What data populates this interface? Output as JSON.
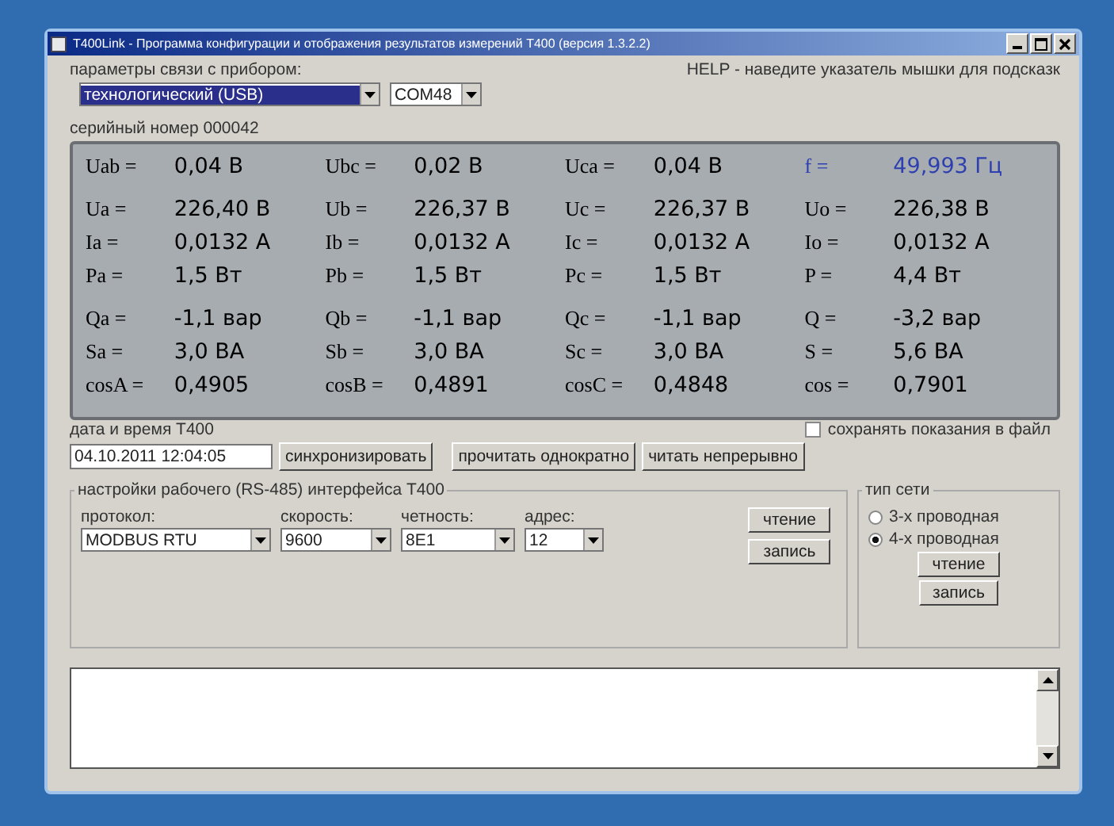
{
  "window": {
    "title": "T400Link - Программа конфигурации и отображения результатов измерений Т400 (версия 1.3.2.2)"
  },
  "connection": {
    "label": "параметры связи с прибором:",
    "help": "HELP - наведите указатель мышки для подсказк",
    "dropdowns": [
      {
        "value": "технологический (USB)",
        "focused": true
      },
      {
        "value": "COM48",
        "focused": false
      }
    ]
  },
  "readings": {
    "title": "серийный номер 000042",
    "rows": [
      [
        {
          "label": "Uab =",
          "value": "0,04 В",
          "color": "#000000"
        },
        {
          "label": "Ubc =",
          "value": "0,02 В",
          "color": "#000000"
        },
        {
          "label": "Uca =",
          "value": "0,04 В",
          "color": "#000000"
        },
        {
          "label": "f =",
          "value": "49,993 Гц",
          "color": "#2e3fb0"
        }
      ],
      [
        {
          "label": "Ua =",
          "value": "226,40 В",
          "color": "#000000"
        },
        {
          "label": "Ub =",
          "value": "226,37 В",
          "color": "#000000"
        },
        {
          "label": "Uc =",
          "value": "226,37 В",
          "color": "#000000"
        },
        {
          "label": "Uo =",
          "value": "226,38 В",
          "color": "#000000"
        }
      ],
      [
        {
          "label": "Ia =",
          "value": "0,0132 А",
          "color": "#000000"
        },
        {
          "label": "Ib =",
          "value": "0,0132 А",
          "color": "#000000"
        },
        {
          "label": "Ic =",
          "value": "0,0132 А",
          "color": "#000000"
        },
        {
          "label": "Io =",
          "value": "0,0132 А",
          "color": "#000000"
        }
      ],
      [
        {
          "label": "Pa =",
          "value": "1,5 Вт",
          "color": "#000000"
        },
        {
          "label": "Pb =",
          "value": "1,5 Вт",
          "color": "#000000"
        },
        {
          "label": "Pc =",
          "value": "1,5 Вт",
          "color": "#000000"
        },
        {
          "label": "P =",
          "value": "4,4 Вт",
          "color": "#000000"
        }
      ],
      [
        {
          "label": "Qa =",
          "value": "-1,1 вар",
          "color": "#000000"
        },
        {
          "label": "Qb =",
          "value": "-1,1 вар",
          "color": "#000000"
        },
        {
          "label": "Qc =",
          "value": "-1,1 вар",
          "color": "#000000"
        },
        {
          "label": "Q =",
          "value": "-3,2 вар",
          "color": "#000000"
        }
      ],
      [
        {
          "label": "Sa =",
          "value": "3,0 ВА",
          "color": "#000000"
        },
        {
          "label": "Sb =",
          "value": "3,0 ВА",
          "color": "#000000"
        },
        {
          "label": "Sc =",
          "value": "3,0 ВА",
          "color": "#000000"
        },
        {
          "label": "S =",
          "value": "5,6 ВА",
          "color": "#000000"
        }
      ],
      [
        {
          "label": "cosA =",
          "value": "0,4905",
          "color": "#000000"
        },
        {
          "label": "cosB =",
          "value": "0,4891",
          "color": "#000000"
        },
        {
          "label": "cosC =",
          "value": "0,4848",
          "color": "#000000"
        },
        {
          "label": "cos =",
          "value": "0,7901",
          "color": "#000000"
        }
      ]
    ]
  },
  "datetime": {
    "label": "дата и время Т400",
    "value": "04.10.2011 12:04:05",
    "save_to_file": {
      "label": "сохранять показания в файл",
      "checked": false
    },
    "buttons": [
      "синхронизировать",
      "прочитать однократно",
      "читать непрерывно"
    ]
  },
  "interface": {
    "title": "настройки рабочего (RS-485) интерфейса Т400",
    "fields": [
      {
        "label": "протокол:",
        "value": "MODBUS RTU"
      },
      {
        "label": "скорость:",
        "value": "9600"
      },
      {
        "label": "четность:",
        "value": "8E1"
      },
      {
        "label": "адрес:",
        "value": "12"
      }
    ],
    "buttons": [
      "чтение",
      "запись"
    ]
  },
  "network": {
    "title": "тип сети",
    "options": [
      {
        "label": "3-х проводная",
        "selected": false
      },
      {
        "label": "4-х проводная",
        "selected": true
      }
    ],
    "buttons": [
      "чтение",
      "запись"
    ]
  }
}
